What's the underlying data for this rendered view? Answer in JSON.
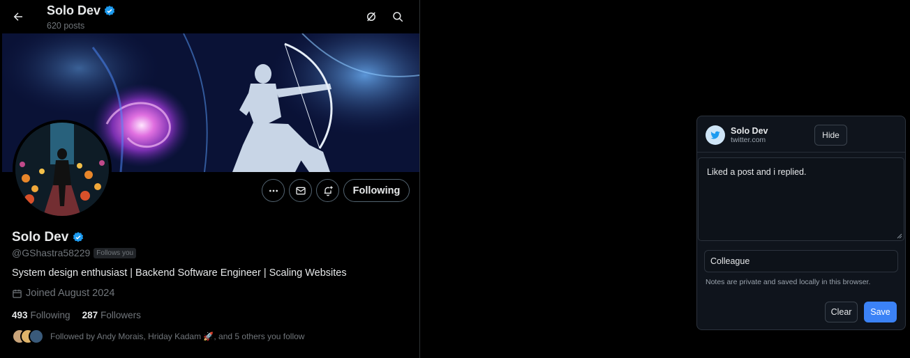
{
  "header": {
    "name": "Solo Dev",
    "posts_count": "620 posts"
  },
  "profile": {
    "name": "Solo Dev",
    "handle": "@GShastra58229",
    "follows_you": "Follows you",
    "bio": "System design enthusiast | Backend Software Engineer | Scaling Websites",
    "joined": "Joined August 2024",
    "following_count": "493",
    "following_label": "Following",
    "followers_count": "287",
    "followers_label": "Followers",
    "followed_by": "Followed by Andy Morais, Hriday Kadam 🚀, and 5 others you follow",
    "following_button": "Following"
  },
  "notes": {
    "title": "Solo Dev",
    "site": "twitter.com",
    "hide_label": "Hide",
    "note_text": "Liked a post and i replied.",
    "tag_value": "Colleague",
    "privacy_note": "Notes are private and saved locally in this browser.",
    "clear_label": "Clear",
    "save_label": "Save"
  },
  "colors": {
    "verified": "#1d9bf0",
    "save_button": "#3b82f6",
    "background": "#000000"
  }
}
